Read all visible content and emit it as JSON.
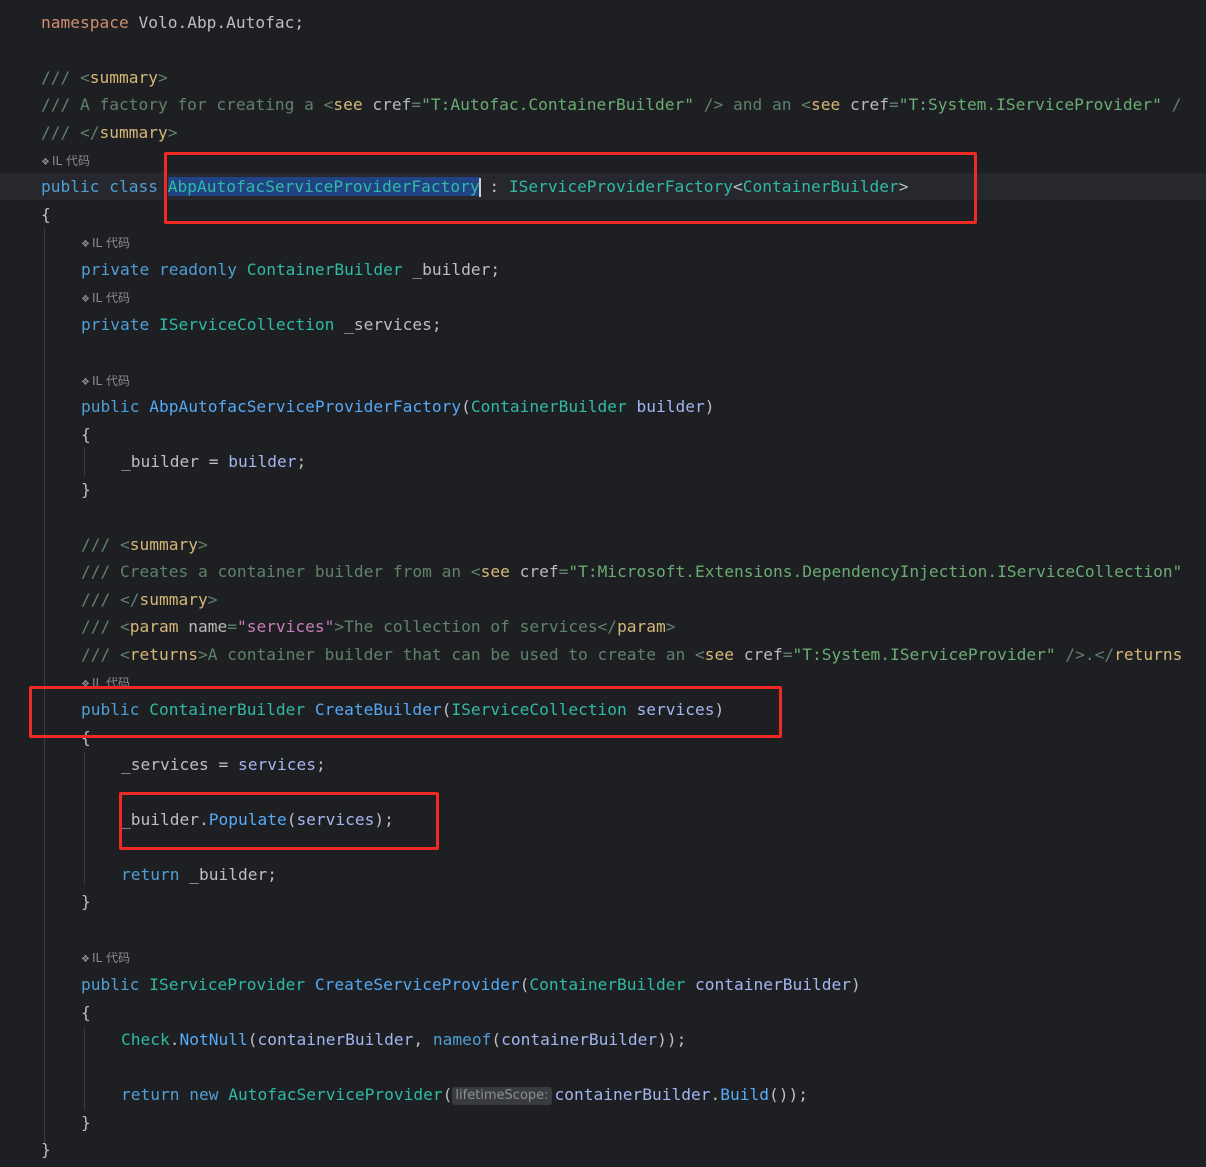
{
  "editor": {
    "il_hint_label": "IL 代码",
    "inlay_hints": {
      "lifetime_scope": "lifetimeScope:"
    },
    "lines": {
      "namespace": {
        "kw": "namespace",
        "rest": " Volo.Abp.Autofac;"
      },
      "sum_open": {
        "slashes": "/// ",
        "tag": "summary"
      },
      "sum_body": {
        "slashes": "/// ",
        "text1": "A factory for creating a ",
        "see1": "see",
        "attr1": "cref",
        "val1": "\"T:Autofac.ContainerBuilder\"",
        "close1": " />",
        "text2": " and an ",
        "see2": "see",
        "attr2": "cref",
        "val2": "\"T:System.IServiceProvider\"",
        "tail": " /"
      },
      "sum_close": {
        "slashes": "/// ",
        "tag": "summary"
      },
      "class_decl": {
        "kw1": "public",
        "kw2": "class",
        "name": "AbpAutofacServiceProviderFactory",
        "colon": " : ",
        "iface": "IServiceProviderFactory",
        "generic": "ContainerBuilder"
      },
      "brace_open": "{",
      "field1": {
        "kw1": "private",
        "kw2": "readonly",
        "type": "ContainerBuilder",
        "name": " _builder;"
      },
      "field2": {
        "kw": "private",
        "type": "IServiceCollection",
        "name": " _services;"
      },
      "ctor": {
        "kw": "public",
        "name": "AbpAutofacServiceProviderFactory",
        "type": "ContainerBuilder",
        "param": "builder"
      },
      "ctor_open": "{",
      "ctor_body": {
        "field": "_builder",
        "eq": " = ",
        "value": "builder",
        "semi": ";"
      },
      "ctor_close": "}",
      "doc2_open": {
        "slashes": "/// ",
        "tag": "summary"
      },
      "doc2_body": {
        "slashes": "/// ",
        "text": "Creates a container builder from an ",
        "see": "see",
        "attr": "cref",
        "val": "\"T:Microsoft.Extensions.DependencyInjection.IServiceCollection\""
      },
      "doc2_close": {
        "slashes": "/// ",
        "tag": "summary"
      },
      "doc2_param": {
        "slashes": "/// ",
        "tag": "param",
        "attr": "name",
        "val": "\"services\"",
        "text": "The collection of services",
        "ctag": "param"
      },
      "doc2_returns": {
        "slashes": "/// ",
        "tag": "returns",
        "text": "A container builder that can be used to create an ",
        "see": "see",
        "attr": "cref",
        "val": "\"T:System.IServiceProvider\"",
        "close": " />.</",
        "ctag": "returns"
      },
      "create_builder": {
        "kw": "public",
        "type": "ContainerBuilder",
        "name": "CreateBuilder",
        "ptype": "IServiceCollection",
        "param": "services"
      },
      "cb_open": "{",
      "cb_assign": {
        "field": "_services",
        "eq": " = ",
        "value": "services",
        "semi": ";"
      },
      "cb_populate": {
        "obj": "_builder",
        "dot": ".",
        "method": "Populate",
        "arg": "services",
        "end": ");"
      },
      "cb_return": {
        "kw": "return",
        "rest": " _builder;"
      },
      "cb_close": "}",
      "create_sp": {
        "kw": "public",
        "type": "IServiceProvider",
        "name": "CreateServiceProvider",
        "ptype": "ContainerBuilder",
        "param": "containerBuilder"
      },
      "sp_open": "{",
      "sp_check": {
        "cls": "Check",
        "method": "NotNull",
        "arg": "containerBuilder",
        "sep": ", ",
        "kw": "nameof",
        "arg2": "containerBuilder",
        "end": "));"
      },
      "sp_return": {
        "kw": "return",
        "kw2": "new",
        "type": "AutofacServiceProvider",
        "arg": "containerBuilder",
        "method": "Build",
        "end": "());"
      },
      "sp_close": "}",
      "brace_close": "}"
    }
  },
  "colors": {
    "background": "#1e1f22",
    "keyword": "#cf8e6d",
    "type": "#2fbaa3",
    "method": "#56a8f5",
    "comment": "#5f826b",
    "annotation_box": "#ef2a24",
    "selection": "#214283"
  }
}
